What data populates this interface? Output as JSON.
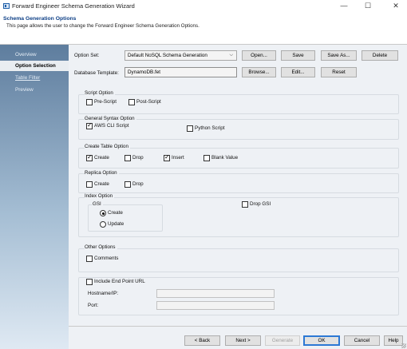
{
  "window": {
    "title": "Forward Engineer Schema Generation Wizard",
    "minimize": "—",
    "maximize": "☐",
    "close": "✕"
  },
  "header": {
    "title": "Schema Generation Options",
    "subtitle": "This page allows the user to change the Forward Engineer Schema Generation Options."
  },
  "sidebar": {
    "items": [
      {
        "label": "Overview"
      },
      {
        "label": "Option Selection"
      },
      {
        "label": "Table Filter"
      },
      {
        "label": "Preview"
      }
    ]
  },
  "option_set": {
    "label": "Option Set:",
    "value": "Default NoSQL Schema Generation",
    "open": "Open...",
    "save": "Save",
    "save_as": "Save As...",
    "delete": "Delete"
  },
  "template": {
    "label": "Database Template:",
    "value": "DynamoDB.fet",
    "browse": "Browse...",
    "edit": "Edit...",
    "reset": "Reset"
  },
  "script_option": {
    "title": "Script Option",
    "pre": "Pre-Script",
    "post": "Post-Script"
  },
  "syntax_option": {
    "title": "General Syntax Option",
    "aws": "AWS CLI Script",
    "python": "Python Script"
  },
  "create_table": {
    "title": "Create Table Option",
    "create": "Create",
    "drop": "Drop",
    "insert": "Insert",
    "blank": "Blank Value"
  },
  "replica": {
    "title": "Replica Option",
    "create": "Create",
    "drop": "Drop"
  },
  "index": {
    "title": "Index Option",
    "gsi": "GSI",
    "create": "Create",
    "update": "Update",
    "drop_gsi": "Drop GSI"
  },
  "other": {
    "title": "Other Options",
    "comments": "Comments"
  },
  "endpoint": {
    "include": "Include End Point URL",
    "host": "Hostname/IP:",
    "port": "Port:",
    "host_value": "",
    "port_value": ""
  },
  "footer": {
    "back": "< Back",
    "next": "Next >",
    "generate": "Generate",
    "ok": "OK",
    "cancel": "Cancel",
    "help": "Help"
  }
}
